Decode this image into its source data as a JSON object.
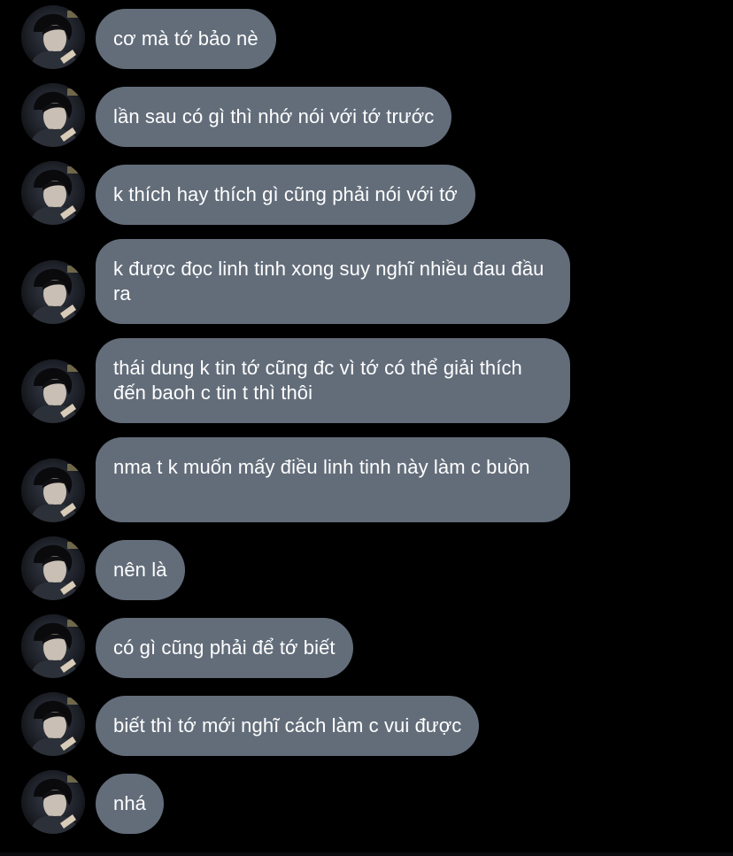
{
  "conversation": {
    "messages": [
      {
        "text": "cơ mà tớ bảo nè"
      },
      {
        "text": "lần sau có gì thì nhớ nói với tớ trước"
      },
      {
        "text": "k thích hay thích gì cũng phải nói với tớ"
      },
      {
        "text": "k được đọc linh tinh xong suy nghĩ nhiều đau đầu ra"
      },
      {
        "text": "thái dung k tin tớ cũng đc vì tớ có thể giải thích đến baoh c tin t thì thôi"
      },
      {
        "text": "nma t k muốn mấy điều linh tinh này làm c buồn"
      },
      {
        "text": "nên là"
      },
      {
        "text": "có gì cũng phải để tớ biết"
      },
      {
        "text": "biết thì tớ mới nghĩ cách làm c vui được"
      },
      {
        "text": "nhá"
      }
    ]
  },
  "colors": {
    "background": "#000000",
    "bubble": "#636d7a",
    "text": "#ffffff"
  }
}
